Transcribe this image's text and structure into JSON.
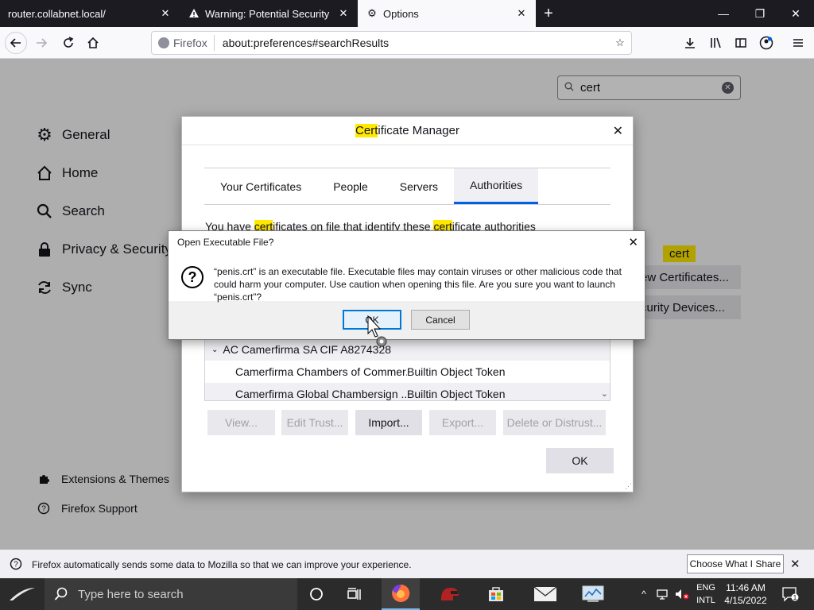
{
  "tabs": [
    {
      "title": "router.collabnet.local/",
      "active": false
    },
    {
      "title": "Warning: Potential Security Ris",
      "active": false
    },
    {
      "title": "Options",
      "active": true
    }
  ],
  "toolbar": {
    "identity_label": "Firefox",
    "url": "about:preferences#searchResults"
  },
  "prefs": {
    "search_value": "cert",
    "categories": [
      {
        "label": "General",
        "icon": "gear-icon"
      },
      {
        "label": "Home",
        "icon": "home-icon"
      },
      {
        "label": "Search",
        "icon": "search-icon"
      },
      {
        "label": "Privacy & Security",
        "icon": "lock-icon"
      },
      {
        "label": "Sync",
        "icon": "sync-icon"
      }
    ],
    "footer": {
      "extensions": "Extensions & Themes",
      "support": "Firefox Support"
    },
    "cert_highlight": "cert",
    "view_certs_visible": "ew Certificates...",
    "security_devices_visible": "curity Devices..."
  },
  "cert_manager": {
    "title_hl": "Cert",
    "title_rest": "ificate Manager",
    "tabs": [
      "Your Certificates",
      "People",
      "Servers",
      "Authorities"
    ],
    "active_tab": "Authorities",
    "description": {
      "p1": "You have ",
      "hl1": "cert",
      "p2": "ificates on file that identify these ",
      "hl2": "cert",
      "p3": "ificate authorities"
    },
    "tree_group": "AC Camerfirma SA CIF A8274328",
    "tree_rows": [
      {
        "name": "Camerfirma Chambers of Commer...",
        "device": "Builtin Object Token"
      },
      {
        "name": "Camerfirma Global Chambersign ...",
        "device": "Builtin Object Token"
      }
    ],
    "buttons": {
      "view": "View...",
      "edit_trust": "Edit Trust...",
      "import": "Import...",
      "export": "Export...",
      "delete": "Delete or Distrust..."
    },
    "ok": "OK"
  },
  "exe_dialog": {
    "title": "Open Executable File?",
    "message": "“penis.crt” is an executable file. Executable files may contain viruses or other malicious code that could harm your computer. Use caution when opening this file. Are you sure you want to launch “penis.crt”?",
    "ok": "OK",
    "cancel": "Cancel"
  },
  "notification": {
    "text": "Firefox automatically sends some data to Mozilla so that we can improve your experience.",
    "button": "Choose What I Share"
  },
  "taskbar": {
    "search_placeholder": "Type here to search",
    "lang_top": "ENG",
    "lang_bottom": "INTL",
    "time": "11:46 AM",
    "date": "4/15/2022",
    "notification_count": "1"
  },
  "colors": {
    "highlight": "#ffe900",
    "accent": "#0061e0",
    "tabstrip": "#1c1b22"
  }
}
